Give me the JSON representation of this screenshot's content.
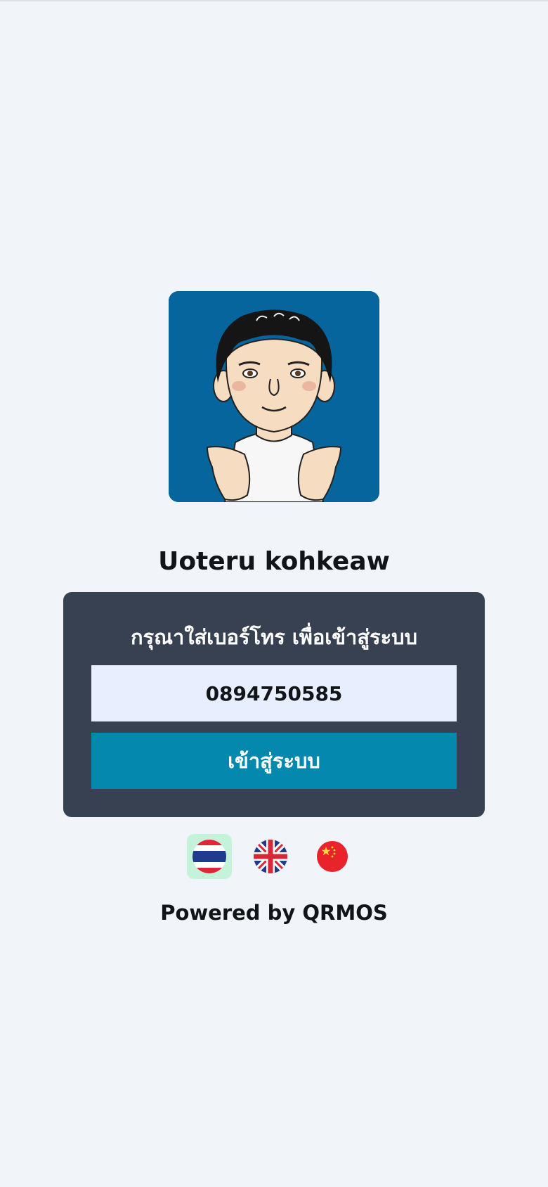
{
  "shop": {
    "name": "Uoteru kohkeaw"
  },
  "login": {
    "title": "กรุณาใส่เบอร์โทร เพื่อเข้าสู่ระบบ",
    "phone_value": "0894750585",
    "submit_label": "เข้าสู่ระบบ"
  },
  "languages": [
    {
      "code": "th",
      "icon": "thailand-flag-icon",
      "active": true
    },
    {
      "code": "en",
      "icon": "uk-flag-icon",
      "active": false
    },
    {
      "code": "zh",
      "icon": "china-flag-icon",
      "active": false
    }
  ],
  "footer": {
    "powered_by": "Powered by QRMOS"
  },
  "colors": {
    "background": "#f1f4f9",
    "card": "#374151",
    "input_bg": "#e7efff",
    "button": "#0488ad",
    "logo_bg": "#07659d",
    "active_lang_bg": "#c4f3d9"
  }
}
